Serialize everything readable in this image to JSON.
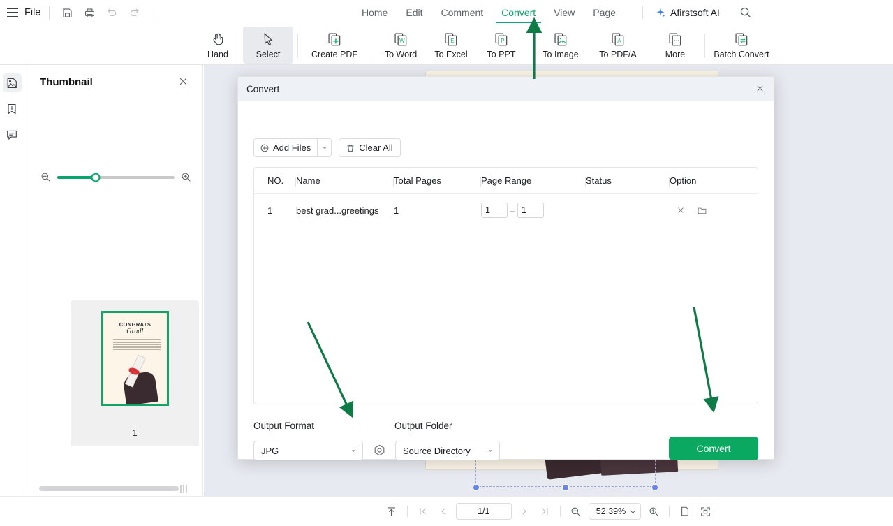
{
  "app": {
    "file_menu": "File",
    "brand": "Afirstsoft AI"
  },
  "menu_tabs": [
    {
      "label": "Home",
      "active": false
    },
    {
      "label": "Edit",
      "active": false
    },
    {
      "label": "Comment",
      "active": false
    },
    {
      "label": "Convert",
      "active": true
    },
    {
      "label": "View",
      "active": false
    },
    {
      "label": "Page",
      "active": false
    }
  ],
  "quick_icons": [
    {
      "name": "save-icon"
    },
    {
      "name": "print-icon"
    },
    {
      "name": "undo-icon"
    },
    {
      "name": "redo-icon"
    }
  ],
  "ribbon": [
    {
      "label": "Hand",
      "icon": "hand-icon",
      "selected": false
    },
    {
      "label": "Select",
      "icon": "cursor-icon",
      "selected": true
    },
    {
      "label": "Create PDF",
      "icon": "create-pdf-icon",
      "selected": false
    },
    {
      "label": "To Word",
      "icon": "to-word-icon",
      "selected": false
    },
    {
      "label": "To Excel",
      "icon": "to-excel-icon",
      "selected": false
    },
    {
      "label": "To PPT",
      "icon": "to-ppt-icon",
      "selected": false
    },
    {
      "label": "To Image",
      "icon": "to-image-icon",
      "selected": false
    },
    {
      "label": "To PDF/A",
      "icon": "to-pdfa-icon",
      "selected": false
    },
    {
      "label": "More",
      "icon": "more-icon",
      "selected": false
    },
    {
      "label": "Batch Convert",
      "icon": "batch-convert-icon",
      "selected": false
    }
  ],
  "rail": [
    {
      "name": "thumbnail-panel-icon",
      "active": true
    },
    {
      "name": "bookmark-add-icon",
      "active": false
    },
    {
      "name": "comment-list-icon",
      "active": false
    }
  ],
  "thumbnail_panel": {
    "title": "Thumbnail",
    "zoom_value": 33,
    "page_number": "1",
    "card": {
      "heading": "CONGRATS",
      "subheading": "Grad!"
    }
  },
  "dialog": {
    "title": "Convert",
    "add_files_label": "Add Files",
    "clear_all_label": "Clear All",
    "columns": [
      "NO.",
      "Name",
      "Total Pages",
      "Page Range",
      "Status",
      "Option"
    ],
    "rows": [
      {
        "no": "1",
        "name": "best grad...greetings",
        "total_pages": "1",
        "range_from": "1",
        "range_to": "1",
        "status": "",
        "range_dash": "—"
      }
    ],
    "output_format_label": "Output Format",
    "output_folder_label": "Output Folder",
    "output_format_value": "JPG",
    "output_folder_value": "Source Directory",
    "convert_label": "Convert"
  },
  "status_bar": {
    "page_indicator": "1/1",
    "zoom_level": "52.39%"
  },
  "colors": {
    "accent_green": "#09a66d",
    "convert_button": "#0ba861",
    "annotation_arrow": "#0e7a45",
    "selection_handle": "#6a85e8",
    "dialog_header": "#eef1f5",
    "doc_background": "#e8eaf1",
    "page_paper": "#fdf6e8"
  }
}
